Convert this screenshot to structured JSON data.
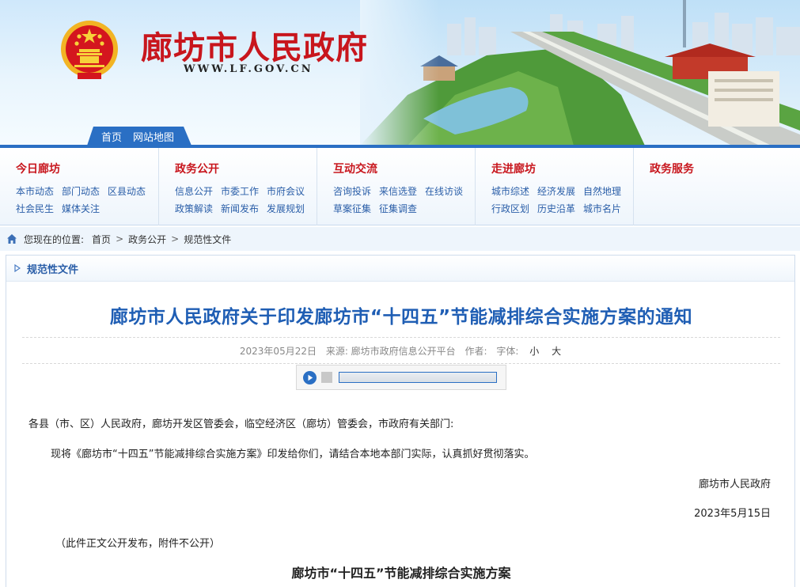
{
  "header": {
    "site_title": "廊坊市人民政府",
    "site_url": "WWW.LF.GOV.CN",
    "tabs": [
      "首页",
      "网站地图"
    ]
  },
  "nav": [
    {
      "title": "今日廊坊",
      "links": [
        "本市动态",
        "部门动态",
        "区县动态",
        "社会民生",
        "媒体关注"
      ]
    },
    {
      "title": "政务公开",
      "links": [
        "信息公开",
        "市委工作",
        "市府会议",
        "政策解读",
        "新闻发布",
        "发展规划"
      ]
    },
    {
      "title": "互动交流",
      "links": [
        "咨询投诉",
        "来信选登",
        "在线访谈",
        "草案征集",
        "征集调查"
      ]
    },
    {
      "title": "走进廊坊",
      "links": [
        "城市综述",
        "经济发展",
        "自然地理",
        "行政区划",
        "历史沿革",
        "城市名片"
      ]
    },
    {
      "title": "政务服务",
      "links": []
    }
  ],
  "breadcrumb": {
    "prefix": "您现在的位置:",
    "items": [
      "首页",
      "政务公开",
      "规范性文件"
    ]
  },
  "section": {
    "label": "规范性文件"
  },
  "article": {
    "title": "廊坊市人民政府关于印发廊坊市“十四五”节能减排综合实施方案的通知",
    "date": "2023年05月22日",
    "source": "来源: 廊坊市政府信息公开平台",
    "author": "作者:",
    "font_label": "字体:",
    "font_small": "小",
    "font_large": "大",
    "salutation": "各县（市、区）人民政府，廊坊开发区管委会，临空经济区（廊坊）管委会，市政府有关部门:",
    "body": "现将《廊坊市“十四五”节能减排综合实施方案》印发给你们，请结合本地本部门实际，认真抓好贯彻落实。",
    "signature": "廊坊市人民政府",
    "sign_date": "2023年5月15日",
    "note": "（此件正文公开发布，附件不公开）",
    "subtitle": "廊坊市“十四五”节能减排综合实施方案"
  },
  "colors": {
    "brand_red": "#c8161d",
    "brand_blue": "#2a6fc4",
    "title_blue": "#1f5eb4",
    "link_blue": "#2a5ea8"
  }
}
